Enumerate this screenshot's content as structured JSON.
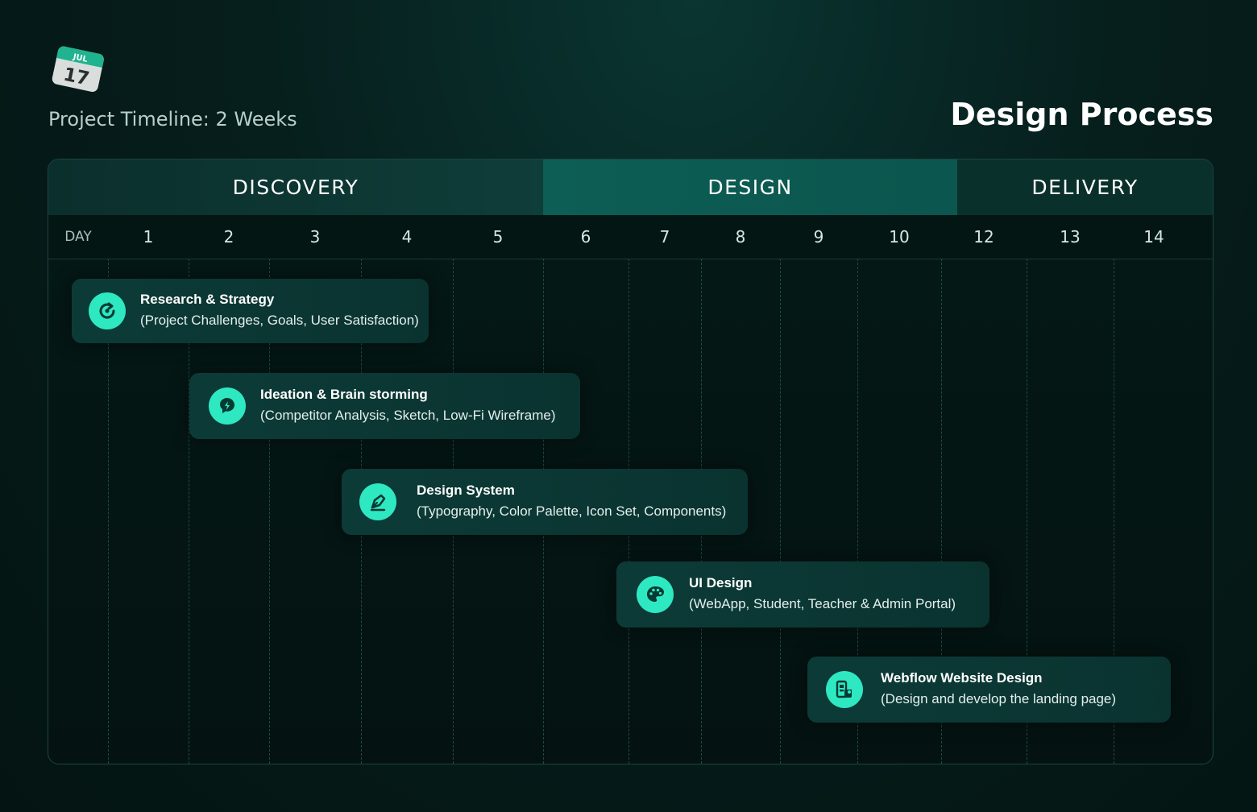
{
  "header": {
    "icon": "calendar-icon",
    "calendar_month": "JUL",
    "calendar_day": "17",
    "timeline_label": "Project Timeline: 2 Weeks",
    "title": "Design Process"
  },
  "phases": [
    {
      "label": "DISCOVERY"
    },
    {
      "label": "DESIGN"
    },
    {
      "label": "DELIVERY"
    }
  ],
  "day_header_label": "DAY",
  "days": [
    "1",
    "2",
    "3",
    "4",
    "5",
    "6",
    "7",
    "8",
    "9",
    "10",
    "12",
    "13",
    "14"
  ],
  "tasks": [
    {
      "title": "Research & Strategy",
      "subtitle": "(Project Challenges, Goals, User Satisfaction)",
      "icon": "refresh-icon"
    },
    {
      "title": "Ideation & Brain storming",
      "subtitle": "(Competitor Analysis, Sketch, Low-Fi Wireframe)",
      "icon": "brain-icon"
    },
    {
      "title": "Design System",
      "subtitle": "(Typography, Color Palette, Icon Set, Components)",
      "icon": "pen-tool-icon"
    },
    {
      "title": "UI Design",
      "subtitle": "(WebApp, Student, Teacher & Admin Portal)",
      "icon": "palette-icon"
    },
    {
      "title": "Webflow Website Design",
      "subtitle": "(Design and develop the landing page)",
      "icon": "devices-icon"
    }
  ],
  "colors": {
    "accent": "#2ee8c2",
    "background": "#041412",
    "phase_design": "#0d5e55"
  }
}
